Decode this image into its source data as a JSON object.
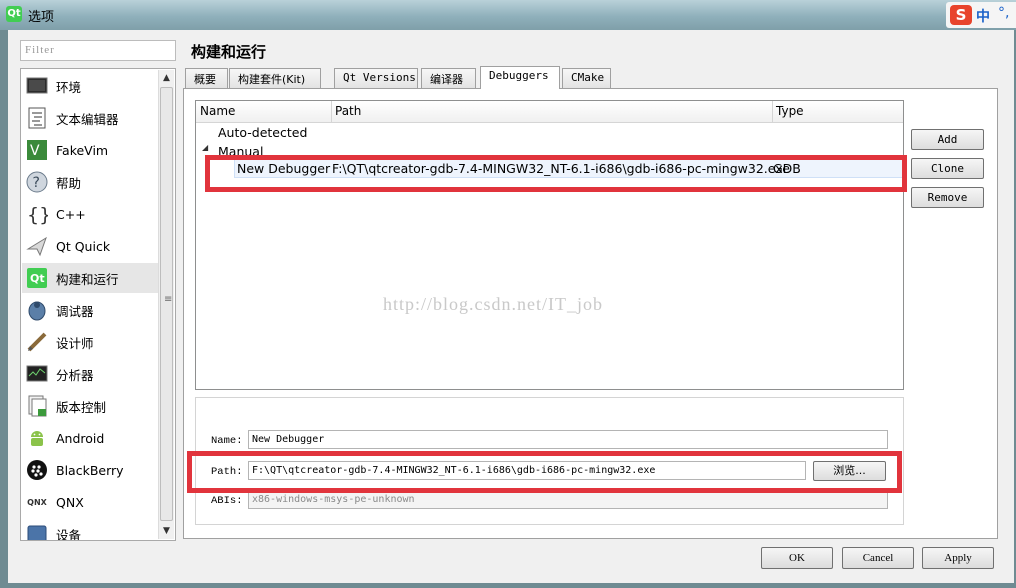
{
  "window": {
    "title": "选项",
    "app_icon": "Qt"
  },
  "ime": {
    "logo": "S",
    "mode": "中",
    "dot": "°,"
  },
  "filter": {
    "placeholder": "Filter"
  },
  "sidebar": {
    "items": [
      {
        "label": "环境",
        "icon": "environment-icon"
      },
      {
        "label": "文本编辑器",
        "icon": "text-editor-icon"
      },
      {
        "label": "FakeVim",
        "icon": "fakevim-icon"
      },
      {
        "label": "帮助",
        "icon": "help-icon"
      },
      {
        "label": "C++",
        "icon": "cpp-icon"
      },
      {
        "label": "Qt Quick",
        "icon": "qt-quick-icon"
      },
      {
        "label": "构建和运行",
        "icon": "build-run-icon",
        "selected": true
      },
      {
        "label": "调试器",
        "icon": "debugger-icon"
      },
      {
        "label": "设计师",
        "icon": "designer-icon"
      },
      {
        "label": "分析器",
        "icon": "analyzer-icon"
      },
      {
        "label": "版本控制",
        "icon": "version-control-icon"
      },
      {
        "label": "Android",
        "icon": "android-icon"
      },
      {
        "label": "BlackBerry",
        "icon": "blackberry-icon"
      },
      {
        "label": "QNX",
        "icon": "qnx-icon"
      },
      {
        "label": "设备",
        "icon": "devices-icon"
      }
    ],
    "qnx_logo_text": "QNX"
  },
  "page": {
    "title": "构建和运行"
  },
  "tabs": [
    {
      "label": "概要"
    },
    {
      "label": "构建套件(Kit)"
    },
    {
      "label": "Qt Versions"
    },
    {
      "label": "编译器"
    },
    {
      "label": "Debuggers",
      "active": true
    },
    {
      "label": "CMake"
    }
  ],
  "tree": {
    "columns": [
      "Name",
      "Path",
      "Type"
    ],
    "auto_detected": "Auto-detected",
    "manual": "Manual",
    "manual_expanded": "◢",
    "entry": {
      "name": "New Debugger",
      "path": "F:\\QT\\qtcreator-gdb-7.4-MINGW32_NT-6.1-i686\\gdb-i686-pc-mingw32.exe",
      "type": "GDB"
    }
  },
  "buttons": {
    "add": "Add",
    "clone": "Clone",
    "remove": "Remove",
    "browse": "浏览...",
    "ok": "OK",
    "cancel": "Cancel",
    "apply": "Apply"
  },
  "details": {
    "name_label": "Name:",
    "name_value": "New Debugger",
    "path_label": "Path:",
    "path_value": "F:\\QT\\qtcreator-gdb-7.4-MINGW32_NT-6.1-i686\\gdb-i686-pc-mingw32.exe",
    "abis_label": "ABIs:",
    "abis_value": "x86-windows-msys-pe-unknown"
  },
  "watermark": "http://blog.csdn.net/IT_job",
  "colors": {
    "highlight": "#e1343c",
    "selection": "#eef4fd"
  }
}
